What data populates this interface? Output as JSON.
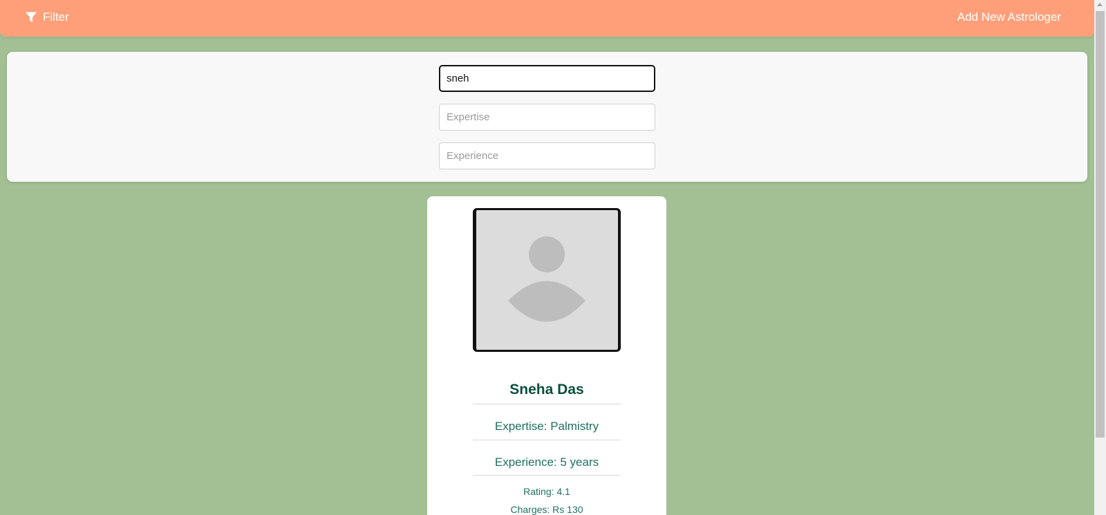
{
  "header": {
    "filter_label": "Filter",
    "filter_icon": "funnel-icon",
    "add_label": "Add New Astrologer",
    "bg_color": "#ff9f7a"
  },
  "filters": {
    "name_value": "sneh",
    "expertise_placeholder": "Expertise",
    "experience_placeholder": "Experience"
  },
  "astrologer": {
    "name": "Sneha Das",
    "expertise": "Expertise: Palmistry",
    "experience": "Experience: 5 years",
    "rating": "Rating: 4.1",
    "charges": "Charges: Rs 130"
  },
  "colors": {
    "page_bg": "#a3bf94",
    "name_color": "#0b4f3e",
    "text_color": "#1f6f60"
  }
}
